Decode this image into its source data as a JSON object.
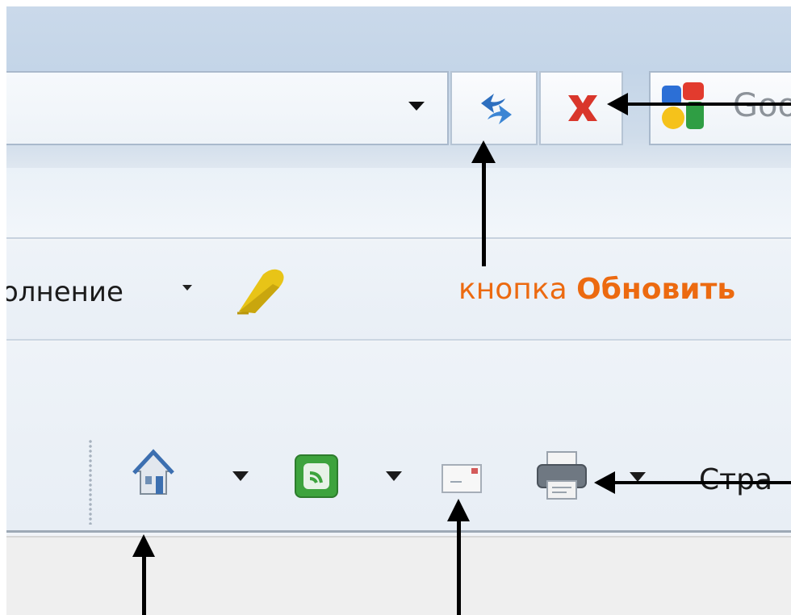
{
  "search": {
    "provider_text": "Goo"
  },
  "suggested_sites": {
    "label_fragment": "олнение"
  },
  "annotations": {
    "refresh_caption_prefix": "кнопка",
    "refresh_caption_bold": "Обновить"
  },
  "command_bar": {
    "page_label": "Стра"
  },
  "icons": {
    "refresh": "refresh-icon",
    "stop": "stop-icon",
    "search_provider": "google-logo-icon",
    "eraser": "eraser-icon",
    "home": "home-icon",
    "feeds": "feeds-icon",
    "mail": "mail-icon",
    "print": "printer-icon"
  },
  "colors": {
    "annotation_text": "#ec6a10",
    "stop_red": "#d9362b",
    "refresh_blue": "#2d6fbf",
    "feeds_green": "#3da33d",
    "arrow": "#000000"
  }
}
